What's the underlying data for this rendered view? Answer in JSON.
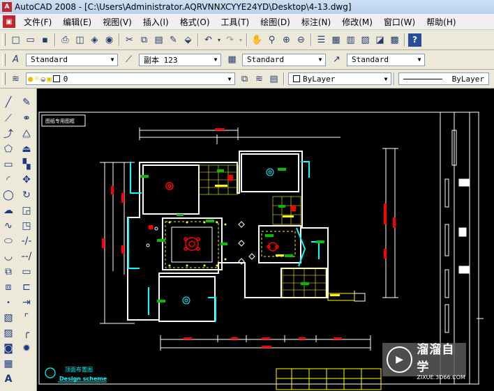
{
  "window": {
    "title": "AutoCAD 2008 - [C:\\Users\\Administrator.AQRVNNXCYYE24YD\\Desktop\\4-13.dwg]",
    "app_icon": "A"
  },
  "menu": [
    "文件(F)",
    "编辑(E)",
    "视图(V)",
    "插入(I)",
    "格式(O)",
    "工具(T)",
    "绘图(D)",
    "标注(N)",
    "修改(M)",
    "窗口(W)",
    "帮助(H)"
  ],
  "styles": {
    "text_style": "Standard",
    "dim_style": "副本 123",
    "table_style": "Standard",
    "multileader_style": "Standard"
  },
  "layers": {
    "current_layer": "0",
    "color": "ByLayer",
    "linetype": "ByLayer"
  },
  "drawing": {
    "title_tag": "图纸专用图框",
    "caption_cn": "顶面布置图",
    "caption_en": "Design scheme"
  },
  "watermark": {
    "name": "溜溜自学",
    "url": "ZIXUE.3D66.COM"
  },
  "colors": {
    "canvas": "#000000",
    "wall": "#ffffff",
    "cyan": "#00ffff",
    "red": "#ff0000",
    "green": "#00c000",
    "yellow": "#ffff00"
  }
}
